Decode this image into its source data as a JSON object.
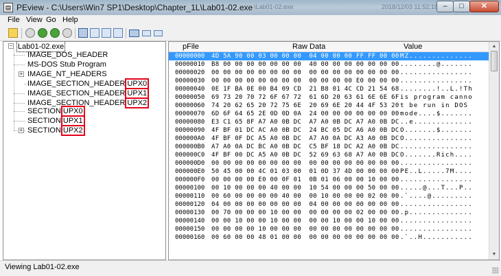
{
  "window": {
    "title": "PEview - C:\\Users\\Win7 SP1\\Desktop\\Chapter_1L\\Lab01-02.exe",
    "ghost_left": "\\Lab01-02.exe",
    "ghost_right": "2018/12/03 11:52:16",
    "minimize_glyph": "–",
    "maximize_glyph": "□",
    "close_glyph": "✕"
  },
  "menu": [
    "File",
    "View",
    "Go",
    "Help"
  ],
  "tree": {
    "root": "Lab01-02.exe",
    "dos_header": "IMAGE_DOS_HEADER",
    "dos_stub": "MS-DOS Stub Program",
    "nt_headers": "IMAGE_NT_HEADERS",
    "section_header_prefix": "IMAGE_SECTION_HEADER",
    "section_prefix": "SECTION",
    "sections": [
      "UPX0",
      "UPX1",
      "UPX2"
    ],
    "highlight_color": "#e5001a"
  },
  "table": {
    "headers": {
      "offset": "pFile",
      "raw": "Raw Data",
      "value": "Value"
    },
    "rows": [
      {
        "off": "00000000",
        "raw": "4D 5A 90 00 03 00 00 00  04 00 00 00 FF FF 00 00",
        "val": "MZ.............."
      },
      {
        "off": "00000010",
        "raw": "B8 00 00 00 00 00 00 00  40 00 00 00 00 00 00 00",
        "val": "........@......."
      },
      {
        "off": "00000020",
        "raw": "00 00 00 00 00 00 00 00  00 00 00 00 00 00 00 00",
        "val": "................"
      },
      {
        "off": "00000030",
        "raw": "00 00 00 00 00 00 00 00  00 00 00 00 E0 00 00 00",
        "val": "................"
      },
      {
        "off": "00000040",
        "raw": "0E 1F BA 0E 00 B4 09 CD  21 B8 01 4C CD 21 54 68",
        "val": "........!..L.!Th"
      },
      {
        "off": "00000050",
        "raw": "69 73 20 70 72 6F 67 72  61 6D 20 63 61 6E 6E 6F",
        "val": "is program canno"
      },
      {
        "off": "00000060",
        "raw": "74 20 62 65 20 72 75 6E  20 69 6E 20 44 4F 53 20",
        "val": "t be run in DOS "
      },
      {
        "off": "00000070",
        "raw": "6D 6F 64 65 2E 0D 0D 0A  24 00 00 00 00 00 00 00",
        "val": "mode....$......."
      },
      {
        "off": "00000080",
        "raw": "E3 C1 65 8F A7 A0 0B DC  A7 A0 0B DC A7 A0 0B DC",
        "val": "..e............."
      },
      {
        "off": "00000090",
        "raw": "4F BF 01 DC AC A0 0B DC  24 BC 05 DC A6 A0 0B DC",
        "val": "O.......$......."
      },
      {
        "off": "000000A0",
        "raw": "4F BF 0F DC A5 A0 0B DC  A7 A0 0A DC A3 A0 0B DC",
        "val": "O..............."
      },
      {
        "off": "000000B0",
        "raw": "A7 A0 0A DC BC A0 0B DC  C5 BF 18 DC A2 A0 0B DC",
        "val": "................"
      },
      {
        "off": "000000C0",
        "raw": "4F BF 00 DC A5 A0 0B DC  52 69 63 68 A7 A0 0B DC",
        "val": "O.......Rich...."
      },
      {
        "off": "000000D0",
        "raw": "00 00 00 00 00 00 00 00  00 00 00 00 00 00 00 00",
        "val": "................"
      },
      {
        "off": "000000E0",
        "raw": "50 45 00 00 4C 01 03 00  01 0D 37 4D 00 00 00 00",
        "val": "PE..L.....7M...."
      },
      {
        "off": "000000F0",
        "raw": "00 00 00 00 E0 00 0F 01  0B 01 06 00 00 10 00 00",
        "val": "................"
      },
      {
        "off": "00000100",
        "raw": "00 10 00 00 00 40 00 00  10 54 00 00 00 50 00 00",
        "val": ".....@...T...P.."
      },
      {
        "off": "00000110",
        "raw": "00 60 00 00 00 00 40 00  00 10 00 00 00 02 00 00",
        "val": ".`....@........."
      },
      {
        "off": "00000120",
        "raw": "04 00 00 00 00 00 00 00  04 00 00 00 00 00 00 00",
        "val": "................"
      },
      {
        "off": "00000130",
        "raw": "00 70 00 00 00 10 00 00  00 00 00 00 02 00 00 00",
        "val": ".p.............."
      },
      {
        "off": "00000140",
        "raw": "00 00 10 00 00 10 00 00  00 00 10 00 00 10 00 00",
        "val": "................"
      },
      {
        "off": "00000150",
        "raw": "00 00 00 00 10 00 00 00  00 00 00 00 00 00 00 00",
        "val": "................"
      },
      {
        "off": "00000160",
        "raw": "00 60 00 00 48 01 00 00  00 00 00 00 00 00 00 00",
        "val": ".`..H..........."
      }
    ]
  },
  "status": "Viewing Lab01-02.exe"
}
